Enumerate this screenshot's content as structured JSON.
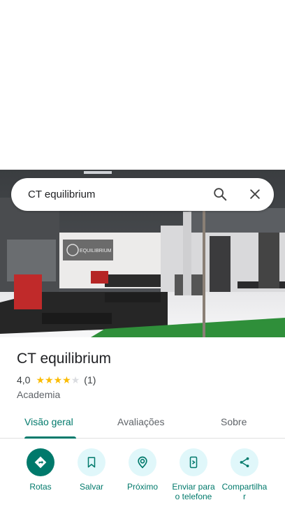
{
  "search": {
    "query": "CT equilibrium"
  },
  "hero_sign": "EQUILIBRIUM",
  "place": {
    "name": "CT equilibrium",
    "rating": "4,0",
    "rating_value": 4,
    "review_count": "(1)",
    "category": "Academia"
  },
  "tabs": [
    {
      "label": "Visão geral",
      "active": true
    },
    {
      "label": "Avaliações",
      "active": false
    },
    {
      "label": "Sobre",
      "active": false
    }
  ],
  "actions": [
    {
      "label": "Rotas",
      "icon": "directions-icon"
    },
    {
      "label": "Salvar",
      "icon": "bookmark-icon"
    },
    {
      "label": "Próximo",
      "icon": "nearby-icon"
    },
    {
      "label": "Enviar para o telefone",
      "icon": "send-to-phone-icon"
    },
    {
      "label": "Compartilhar",
      "icon": "share-icon"
    }
  ],
  "colors": {
    "accent": "#00796b",
    "accent_light": "#e0f7fa",
    "star": "#fbbc04"
  }
}
